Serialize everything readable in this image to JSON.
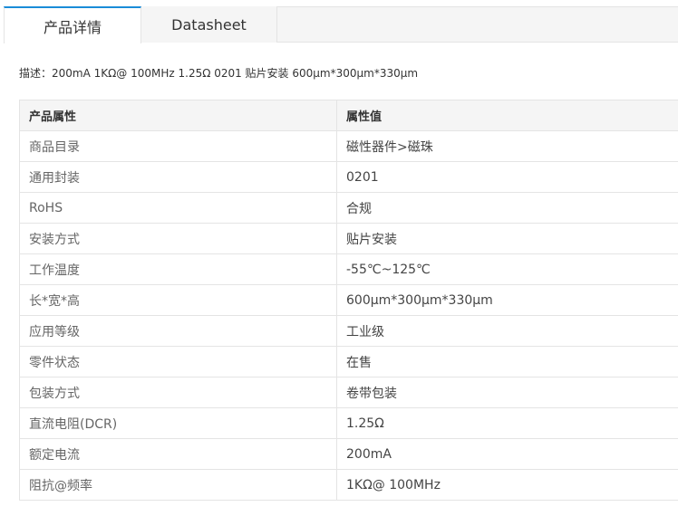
{
  "tabs": [
    {
      "label": "产品详情",
      "active": true
    },
    {
      "label": "Datasheet",
      "active": false
    }
  ],
  "description": "描述：200mA 1KΩ@ 100MHz 1.25Ω 0201 贴片安装 600μm*300μm*330μm",
  "table": {
    "headers": [
      "产品属性",
      "属性值"
    ],
    "rows": [
      {
        "name": "商品目录",
        "value": "磁性器件>磁珠"
      },
      {
        "name": "通用封装",
        "value": "0201"
      },
      {
        "name": "RoHS",
        "value": "合规"
      },
      {
        "name": "安装方式",
        "value": "贴片安装"
      },
      {
        "name": "工作温度",
        "value": "-55℃~125℃"
      },
      {
        "name": "长*宽*高",
        "value": "600μm*300μm*330μm"
      },
      {
        "name": "应用等级",
        "value": "工业级"
      },
      {
        "name": "零件状态",
        "value": "在售"
      },
      {
        "name": "包装方式",
        "value": "卷带包装"
      },
      {
        "name": "直流电阻(DCR)",
        "value": "1.25Ω"
      },
      {
        "name": "额定电流",
        "value": "200mA"
      },
      {
        "name": "阻抗@频率",
        "value": "1KΩ@ 100MHz"
      }
    ]
  },
  "colors": {
    "accent": "#1a8cd8",
    "border": "#e4e4e4",
    "header_bg": "#f5f5f5"
  }
}
